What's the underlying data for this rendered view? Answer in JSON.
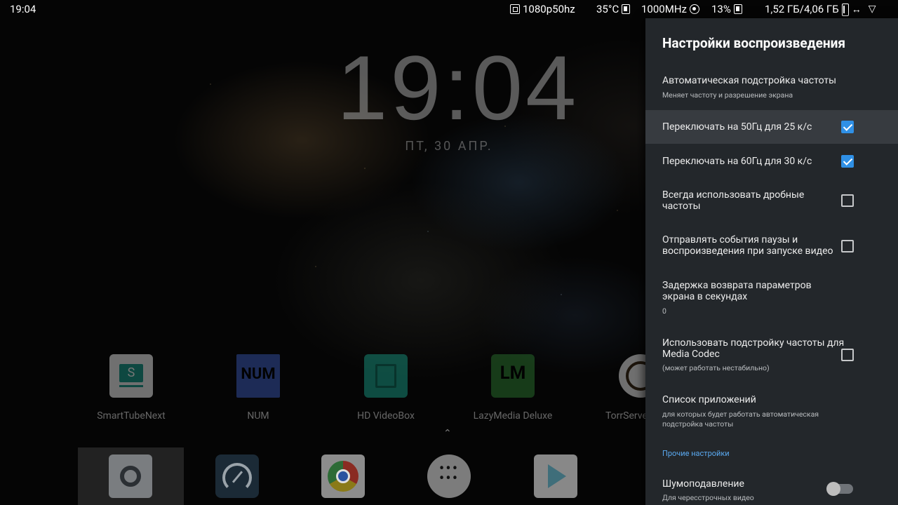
{
  "status_bar": {
    "time": "19:04",
    "resolution": "1080p50hz",
    "temperature": "35°C",
    "cpu_freq": "1000MHz",
    "cpu_load": "13%",
    "memory": "1,52 ГБ/4,06 ГБ"
  },
  "clock": {
    "time": "19:04",
    "date": "ПТ, 30 АПР."
  },
  "apps": [
    {
      "label": "SmartTubeNext",
      "icon": "smarttube-icon",
      "color": "#ffffff"
    },
    {
      "label": "NUM",
      "icon": "num-icon",
      "icon_text": "NUM",
      "color": "#3a5bb8"
    },
    {
      "label": "HD VideoBox",
      "icon": "hdvideobox-icon",
      "color": "#1aa38c"
    },
    {
      "label": "LazyMedia Deluxe",
      "icon": "lazymedia-icon",
      "icon_text": "LM",
      "color": "#2e7d32"
    },
    {
      "label": "TorrServe",
      "icon": "torrserve-icon",
      "color": "#ffffff"
    }
  ],
  "dock": [
    {
      "icon": "settings-icon"
    },
    {
      "icon": "speedometer-icon"
    },
    {
      "icon": "chrome-icon"
    },
    {
      "icon": "all-apps-icon"
    },
    {
      "icon": "play-store-icon"
    }
  ],
  "panel": {
    "title": "Настройки воспроизведения",
    "items": [
      {
        "title": "Автоматическая подстройка частоты",
        "summary": "Меняет частоту и разрешение экрана"
      },
      {
        "title": "Переключать на 50Гц для 25 к/с",
        "checked": true
      },
      {
        "title": "Переключать на 60Гц для 30 к/с",
        "checked": true
      },
      {
        "title": "Всегда использовать дробные частоты",
        "checked": false
      },
      {
        "title": "Отправлять события паузы и воспроизведения при запуске видео",
        "checked": false
      },
      {
        "title": "Задержка возврата параметров экрана в секундах",
        "summary": "0"
      },
      {
        "title": "Использовать подстройку частоты для Media Codec",
        "summary": "(может работать нестабильно)",
        "checked": false
      },
      {
        "title": "Список приложений",
        "summary": "для которых будет работать автоматическая подстройка частоты"
      }
    ],
    "section_other": "Прочие настройки",
    "noise": {
      "title": "Шумоподавление",
      "summary": "Для чересстрочных видео",
      "enabled": false
    }
  },
  "colors": {
    "panel_bg": "#23272b",
    "focused_row": "#373b40",
    "accent": "#2f90e6",
    "section_label": "#5aa9f0"
  }
}
